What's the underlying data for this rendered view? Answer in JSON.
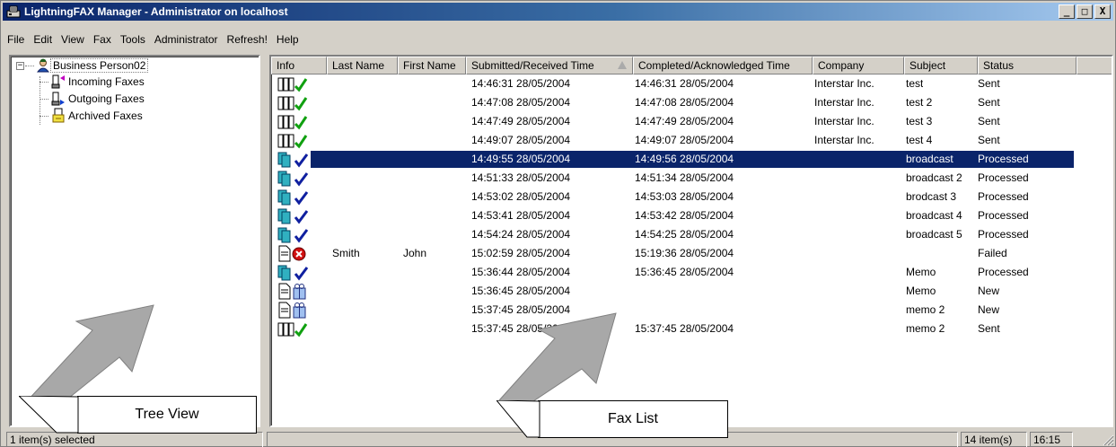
{
  "window": {
    "title": "LightningFAX Manager - Administrator on localhost",
    "controls": [
      "_",
      "□",
      "X"
    ]
  },
  "menu": [
    "File",
    "Edit",
    "View",
    "Fax",
    "Tools",
    "Administrator",
    "Refresh!",
    "Help"
  ],
  "tree": {
    "root": "Business Person02",
    "children": [
      "Incoming Faxes",
      "Outgoing Faxes",
      "Archived Faxes"
    ]
  },
  "columns": [
    "Info",
    "Last Name",
    "First Name",
    "Submitted/Received Time",
    "Completed/Acknowledged Time",
    "Company",
    "Subject",
    "Status"
  ],
  "rows": [
    {
      "icon": "sent",
      "last": "",
      "first": "",
      "submitted": "14:46:31  28/05/2004",
      "completed": "14:46:31  28/05/2004",
      "company": "Interstar Inc.",
      "subject": "test",
      "status": "Sent"
    },
    {
      "icon": "sent",
      "last": "",
      "first": "",
      "submitted": "14:47:08  28/05/2004",
      "completed": "14:47:08  28/05/2004",
      "company": "Interstar Inc.",
      "subject": "test 2",
      "status": "Sent"
    },
    {
      "icon": "sent",
      "last": "",
      "first": "",
      "submitted": "14:47:49  28/05/2004",
      "completed": "14:47:49  28/05/2004",
      "company": "Interstar Inc.",
      "subject": "test 3",
      "status": "Sent"
    },
    {
      "icon": "sent",
      "last": "",
      "first": "",
      "submitted": "14:49:07  28/05/2004",
      "completed": "14:49:07  28/05/2004",
      "company": "Interstar Inc.",
      "subject": "test 4",
      "status": "Sent"
    },
    {
      "icon": "broadcast",
      "last": "",
      "first": "",
      "submitted": "14:49:55  28/05/2004",
      "completed": "14:49:56  28/05/2004",
      "company": "",
      "subject": "broadcast",
      "status": "Processed",
      "selected": true
    },
    {
      "icon": "broadcast",
      "last": "",
      "first": "",
      "submitted": "14:51:33  28/05/2004",
      "completed": "14:51:34  28/05/2004",
      "company": "",
      "subject": "broadcast 2",
      "status": "Processed"
    },
    {
      "icon": "broadcast",
      "last": "",
      "first": "",
      "submitted": "14:53:02  28/05/2004",
      "completed": "14:53:03  28/05/2004",
      "company": "",
      "subject": "brodcast 3",
      "status": "Processed"
    },
    {
      "icon": "broadcast",
      "last": "",
      "first": "",
      "submitted": "14:53:41  28/05/2004",
      "completed": "14:53:42  28/05/2004",
      "company": "",
      "subject": "broadcast 4",
      "status": "Processed"
    },
    {
      "icon": "broadcast",
      "last": "",
      "first": "",
      "submitted": "14:54:24  28/05/2004",
      "completed": "14:54:25  28/05/2004",
      "company": "",
      "subject": "broadcast 5",
      "status": "Processed"
    },
    {
      "icon": "failed",
      "last": "Smith",
      "first": "John",
      "submitted": "15:02:59  28/05/2004",
      "completed": "15:19:36  28/05/2004",
      "company": "",
      "subject": "",
      "status": "Failed"
    },
    {
      "icon": "broadcast",
      "last": "",
      "first": "",
      "submitted": "15:36:44  28/05/2004",
      "completed": "15:36:45  28/05/2004",
      "company": "",
      "subject": "Memo",
      "status": "Processed"
    },
    {
      "icon": "new",
      "last": "",
      "first": "",
      "submitted": "15:36:45  28/05/2004",
      "completed": "",
      "company": "",
      "subject": "Memo",
      "status": "New"
    },
    {
      "icon": "new",
      "last": "",
      "first": "",
      "submitted": "15:37:45  28/05/2004",
      "completed": "",
      "company": "",
      "subject": "memo 2",
      "status": "New"
    },
    {
      "icon": "sent",
      "last": "",
      "first": "",
      "submitted": "15:37:45  28/05/2004",
      "completed": "15:37:45  28/05/2004",
      "company": "",
      "subject": "memo 2",
      "status": "Sent"
    }
  ],
  "status": {
    "left": "1 item(s) selected",
    "count": "14 item(s)",
    "time": "16:15"
  },
  "annotations": {
    "tree": "Tree View",
    "list": "Fax List"
  },
  "colors": {
    "selection": "#0a246a",
    "titlebar": "#0a246a",
    "check_green": "#10a010",
    "check_blue": "#1020a0",
    "failed": "#d01010"
  }
}
